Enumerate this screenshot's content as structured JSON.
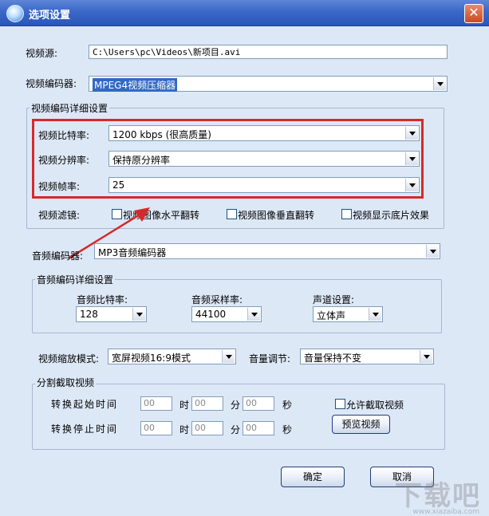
{
  "window": {
    "title": "选项设置",
    "close_glyph": "✕"
  },
  "video_source": {
    "label": "视频源:",
    "value": "C:\\Users\\pc\\Videos\\新项目.avi"
  },
  "video_encoder": {
    "label": "视频编码器:",
    "value": "MPEG4视频压缩器"
  },
  "video_detail": {
    "title": "视频编码详细设置",
    "bitrate_label": "视频比特率:",
    "bitrate_value": "1200 kbps (很高质量)",
    "resolution_label": "视频分辨率:",
    "resolution_value": "保持原分辨率",
    "framerate_label": "视频帧率:",
    "framerate_value": "25",
    "filter_label": "视频滤镜:",
    "filters": [
      "视频图像水平翻转",
      "视频图像垂直翻转",
      "视频显示底片效果"
    ]
  },
  "audio_encoder": {
    "label": "音频编码器:",
    "value": "MP3音频编码器"
  },
  "audio_detail": {
    "title": "音频编码详细设置",
    "bitrate_label": "音频比特率:",
    "bitrate_value": "128",
    "samplerate_label": "音频采样率:",
    "samplerate_value": "44100",
    "channel_label": "声道设置:",
    "channel_value": "立体声"
  },
  "scale_mode": {
    "label": "视频缩放模式:",
    "value": "宽屏视频16:9模式"
  },
  "volume": {
    "label": "音量调节:",
    "value": "音量保持不变"
  },
  "split": {
    "title": "分割截取视频",
    "start_label": "转换起始时间",
    "end_label": "转换停止时间",
    "hour_unit": "时",
    "minute_unit": "分",
    "second_unit": "秒",
    "start_values": [
      "00",
      "00",
      "00"
    ],
    "end_values": [
      "00",
      "00",
      "00"
    ],
    "allow_label": "允许截取视频",
    "preview_button": "预览视频"
  },
  "buttons": {
    "ok": "确定",
    "cancel": "取消"
  },
  "watermark": {
    "main": "下载吧",
    "sub": "www.xiazaiba.com"
  },
  "colors": {
    "highlight": "#d62a2a",
    "titlebar": "#3b68c7",
    "background": "#dde8f7"
  }
}
